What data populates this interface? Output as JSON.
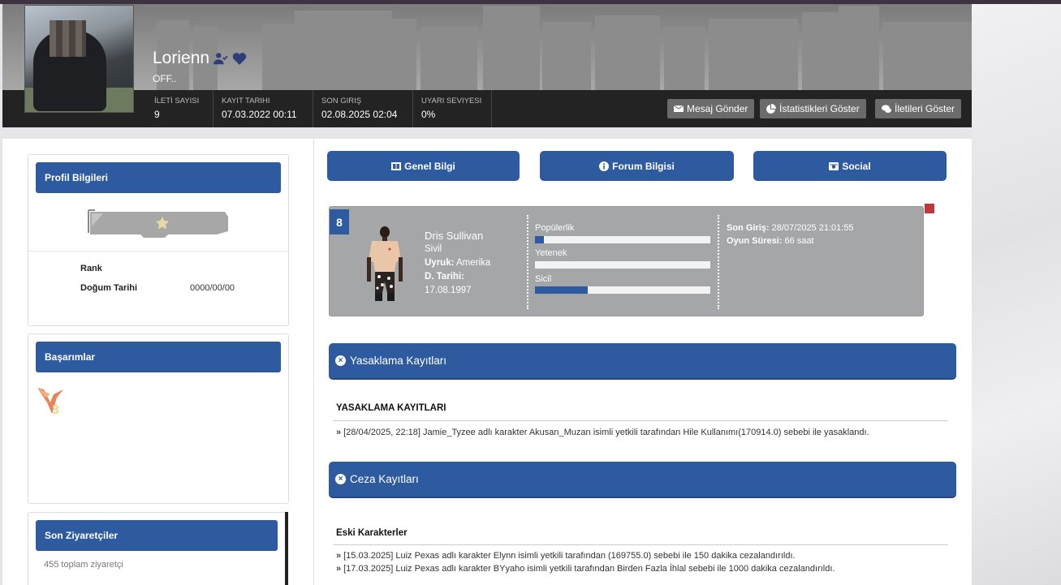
{
  "profile": {
    "username": "Lorienn",
    "status": "OFF..",
    "icons": [
      "user-check-icon",
      "heart-icon"
    ]
  },
  "stats": [
    {
      "label": "İLETİ SAYISI",
      "value": "9"
    },
    {
      "label": "KAYIT TARIHI",
      "value": "07.03.2022 00:11"
    },
    {
      "label": "SON GIRIŞ",
      "value": "02.08.2025 02:04"
    },
    {
      "label": "UYARI SEVIYESI",
      "value": "0%"
    }
  ],
  "header_buttons": {
    "message": "Mesaj Gönder",
    "statistics": "İstatistikleri Göster",
    "posts": "İletileri Göster"
  },
  "sidebar": {
    "profile_info": {
      "title": "Profil Bilgileri",
      "rank_label": "Rank",
      "birth_label": "Doğum Tarihi",
      "birth_value": "0000/00/00"
    },
    "achievements": {
      "title": "Başarımlar"
    },
    "visitors": {
      "title": "Son Ziyaretçiler",
      "count_text": "455 toplam ziyaretçi"
    }
  },
  "tabs": {
    "general": "Genel Bilgi",
    "forum": "Forum Bilgisi",
    "social": "Social"
  },
  "character": {
    "number": "8",
    "name": "Dris Sullivan",
    "role": "Sivil",
    "nationality_label": "Uyruk:",
    "nationality_value": "Amerika",
    "birth_label": "D. Tarihi:",
    "birth_value": "17.08.1997",
    "bars": [
      {
        "label": "Popülerlik",
        "level_percent": 5
      },
      {
        "label": "Yetenek",
        "level_percent": 0
      },
      {
        "label": "Sicil",
        "level_percent": 30
      }
    ],
    "last_login_label": "Son Giriş:",
    "last_login_value": "28/07/2025 21:01:55",
    "playtime_label": "Oyun Süresi:",
    "playtime_value": "66 saat"
  },
  "bans": {
    "panel_title": "Yasaklama Kayıtları",
    "section_title": "YASAKLAMA KAYITLARI",
    "entries": [
      "[28/04/2025, 22:18] Jamie_Tyzee adlı karakter Akusan_Muzan isimli yetkili tarafından Hile Kullanımı(170914.0) sebebi ile yasaklandı."
    ]
  },
  "penalties": {
    "panel_title": "Ceza Kayıtları",
    "section_title": "Eski Karakterler",
    "entries": [
      "[15.03.2025] Luiz Pexas adlı karakter Elynn isimli yetkili tarafından (169755.0) sebebi ile 150 dakika cezalandırıldı.",
      "[17.03.2025] Luiz Pexas adlı karakter BYyaho isimli yetkili tarafından Birden Fazla İhlal sebebi ile 1000 dakika cezalandırıldı."
    ]
  },
  "colors": {
    "accent": "#2e5a9f",
    "stats_bar": "#232323",
    "header_button": "#6b6b6b",
    "char_box": "#a5a6a8",
    "indicator": "#c2373c"
  }
}
